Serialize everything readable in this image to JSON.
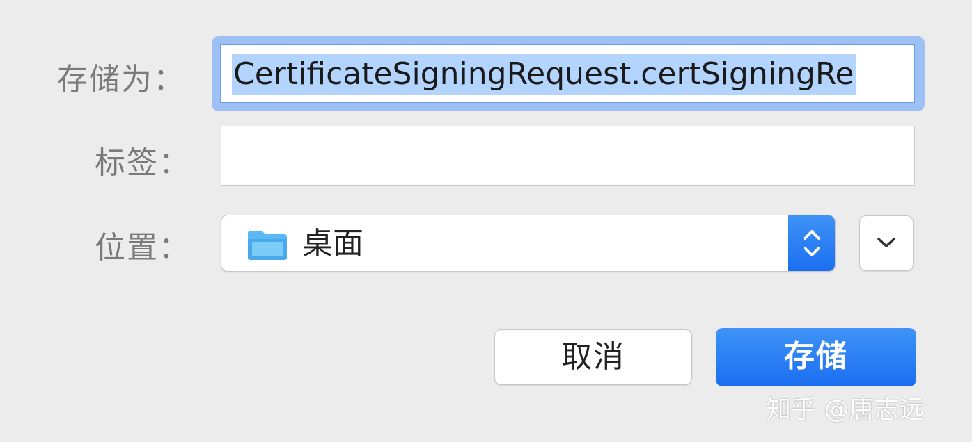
{
  "form": {
    "save_as_label": "存储为：",
    "save_as_value": "CertificateSigningRequest.certSigningRe",
    "tags_label": "标签：",
    "tags_value": "",
    "where_label": "位置：",
    "where_value": "桌面",
    "where_icon": "folder-icon",
    "stepper_icon": "up-down-chevron-icon",
    "expand_icon": "chevron-down-icon"
  },
  "buttons": {
    "cancel_label": "取消",
    "save_label": "存储"
  },
  "watermark": {
    "text": "知乎 @唐志远"
  },
  "colors": {
    "accent": "#1b6ef0",
    "selection": "#b3d4fd",
    "focus_ring": "#9dc1f4",
    "folder": "#5ab8f5"
  }
}
